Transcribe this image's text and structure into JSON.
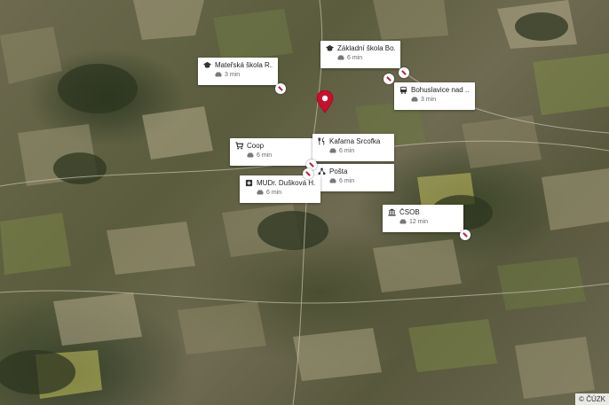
{
  "map": {
    "attribution": "© ČÚZK",
    "accent_color": "#c8102e"
  },
  "pois": [
    {
      "name": "Mateřská škola R...",
      "time": "3 min",
      "icon": "school-icon"
    },
    {
      "name": "Základní škola Bo...",
      "time": "6 min",
      "icon": "school-icon"
    },
    {
      "name": "Bohuslavice nad ...",
      "time": "3 min",
      "icon": "bus-icon"
    },
    {
      "name": "Coop",
      "time": "6 min",
      "icon": "shopping-cart-icon"
    },
    {
      "name": "Kafarna Srcofka",
      "time": "6 min",
      "icon": "restaurant-icon"
    },
    {
      "name": "Pošta",
      "time": "6 min",
      "icon": "post-office-icon"
    },
    {
      "name": "MUDr. Dušková H...",
      "time": "6 min",
      "icon": "medical-icon"
    },
    {
      "name": "ČSOB",
      "time": "12 min",
      "icon": "bank-icon"
    }
  ]
}
